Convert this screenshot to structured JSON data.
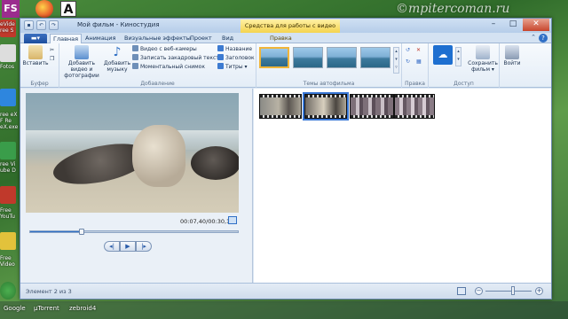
{
  "desktop": {
    "top_icons": {
      "fs_letters": "FS",
      "a_letter": "A"
    },
    "watermark": "©mpitercoman.ru",
    "left_labels": [
      "eVide",
      "ree S",
      "Fotos",
      "ree eX",
      "F Re",
      "eX.exe",
      "ree Vi",
      "ube D",
      "Free",
      "YouTu",
      "Free",
      "Video"
    ],
    "taskbar_labels": [
      "Google",
      "µTorrent",
      "zebroid4"
    ]
  },
  "window": {
    "title": "Мой фильм - Киностудия",
    "context_header": "Средства для работы с видео",
    "qat_buttons": [
      "save-icon",
      "undo-icon",
      "redo-icon"
    ],
    "tabs": [
      {
        "label": "Главная",
        "active": true
      },
      {
        "label": "Анимация",
        "active": false
      },
      {
        "label": "Визуальные эффекты",
        "active": false
      },
      {
        "label": "Проект",
        "active": false
      },
      {
        "label": "Вид",
        "active": false
      },
      {
        "label": "Правка",
        "active": false,
        "context": true
      }
    ]
  },
  "ribbon": {
    "clipboard": {
      "paste": "Вставить",
      "label": "Буфер"
    },
    "add": {
      "add_video": "Добавить видео и фотографии",
      "add_music": "Добавить музыку",
      "webcam": "Видео с веб-камеры",
      "narration": "Записать закадровый текст",
      "snapshot": "Моментальный снимок",
      "title": "Название",
      "caption": "Заголовок",
      "credits": "Титры",
      "label": "Добавление"
    },
    "themes": {
      "label": "Темы автофильма"
    },
    "edit": {
      "label": "Правка"
    },
    "share": {
      "save_movie": "Сохранить фильм",
      "label": "Доступ"
    },
    "exit": {
      "label": "Войти"
    }
  },
  "preview": {
    "timecode": "00:07,40/00:30,13",
    "progress_fraction": 0.246
  },
  "storyboard": {
    "clips": [
      {
        "name": "clip-1",
        "selected": false
      },
      {
        "name": "clip-2",
        "selected": true
      },
      {
        "name": "clip-3",
        "selected": false
      },
      {
        "name": "clip-4",
        "selected": false
      }
    ]
  },
  "status": {
    "text": "Элемент 2 из 3",
    "zoom_fraction": 0.6
  },
  "colors": {
    "accent": "#2f6fc6",
    "context_tab": "#f4d34e",
    "ribbon_bg": "#f7fafd"
  }
}
